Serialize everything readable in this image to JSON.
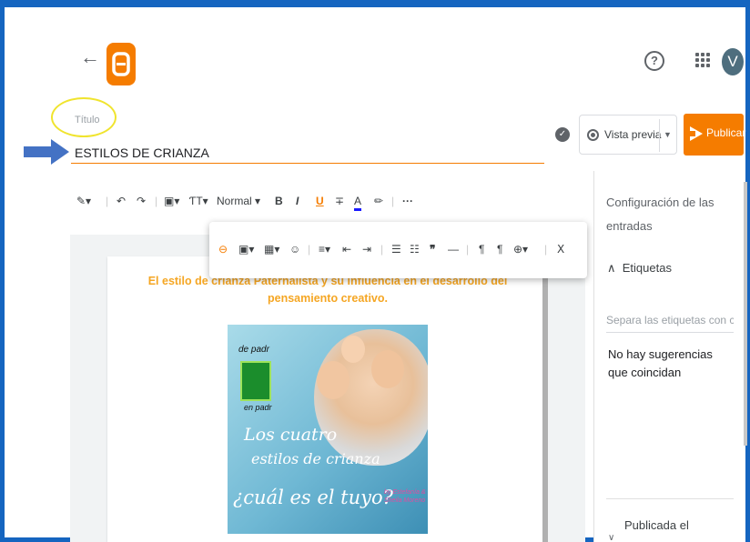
{
  "header": {
    "back_icon": "arrow-left-icon",
    "help_icon": "help-circle-icon",
    "apps_icon": "apps-grid-icon",
    "avatar_letter": "V"
  },
  "post": {
    "title_label": "Título",
    "title_value": "ESTILOS DE CRIANZA"
  },
  "actions": {
    "preview_label": "Vista previa",
    "publish_label": "Publicar"
  },
  "toolbar": {
    "format_label": "Normal",
    "bold": "B",
    "italic": "I",
    "underline": "U",
    "strike": "∓",
    "text_color": "A",
    "more": "···"
  },
  "editor": {
    "headline": "El estilo de crianza Paternalista y su influencia en el desarrollo del pensamiento creativo.",
    "image_text_top": "de padr",
    "image_text_logo": "en padr",
    "image_line1": "Los cuatro",
    "image_line2": "estilos de crianza",
    "image_line3": "¿cuál es el tuyo?",
    "image_authors": "by Estefanía & Sheila Moreno"
  },
  "sidebar": {
    "title": "Configuración de las entradas",
    "labels_section": "Etiquetas",
    "labels_placeholder": "Separa las etiquetas con c...",
    "no_suggestions": "No hay sugerencias que coincidan",
    "published_label": "Publicada el"
  },
  "colors": {
    "accent": "#f57c00",
    "frame": "#1565c0",
    "headline": "#f5a623",
    "highlight_circle": "#f0e42e"
  }
}
